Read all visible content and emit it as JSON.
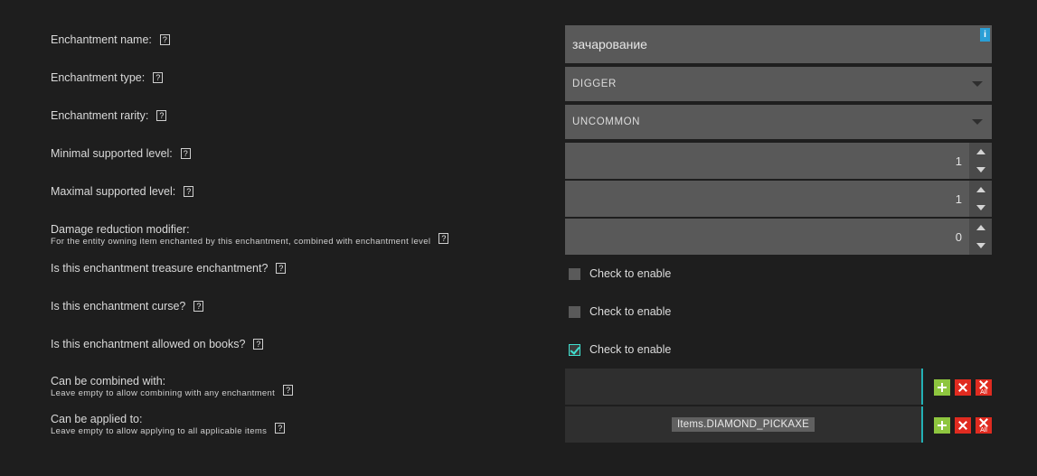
{
  "colors": {
    "background": "#1e1e1e",
    "field": "#595959",
    "list": "#2f2f2f",
    "accent_cyan": "#23b0b5",
    "accent_green": "#8ec63f",
    "accent_red": "#e02b20",
    "accent_blue": "#2a9fd6",
    "check_cyan": "#3fe0d0"
  },
  "help_glyph": "?",
  "labels": [
    {
      "main": "Enchantment name:",
      "sub": ""
    },
    {
      "main": "Enchantment type:",
      "sub": ""
    },
    {
      "main": "Enchantment rarity:",
      "sub": ""
    },
    {
      "main": "Minimal supported level:",
      "sub": ""
    },
    {
      "main": "Maximal supported level:",
      "sub": ""
    },
    {
      "main": "Damage reduction modifier:",
      "sub": "For the entity owning item enchanted by this enchantment, combined with enchantment level"
    },
    {
      "main": "Is this enchantment treasure enchantment?",
      "sub": ""
    },
    {
      "main": "Is this enchantment curse?",
      "sub": ""
    },
    {
      "main": "Is this enchantment allowed on books?",
      "sub": ""
    },
    {
      "main": "Can be combined with:",
      "sub": "Leave empty to allow combining with any enchantment"
    },
    {
      "main": "Can be applied to:",
      "sub": "Leave empty to allow applying to all applicable items"
    }
  ],
  "fields": {
    "enchantment_name": {
      "value": "зачарование",
      "placeholder": "",
      "info_badge": "i"
    },
    "enchantment_type": {
      "value": "DIGGER"
    },
    "enchantment_rarity": {
      "value": "UNCOMMON"
    },
    "minimal_level": {
      "value": "1"
    },
    "maximal_level": {
      "value": "1"
    },
    "damage_reduction": {
      "value": "0"
    }
  },
  "checkboxes": [
    {
      "label": "Check to enable",
      "checked": false
    },
    {
      "label": "Check to enable",
      "checked": false
    },
    {
      "label": "Check to enable",
      "checked": true
    }
  ],
  "lists": [
    {
      "items": []
    },
    {
      "items": [
        "Items.DIAMOND_PICKAXE"
      ]
    }
  ],
  "list_buttons": {
    "add": "+",
    "remove": "×",
    "remove_all_glyph": "×",
    "remove_all_label": "All"
  }
}
